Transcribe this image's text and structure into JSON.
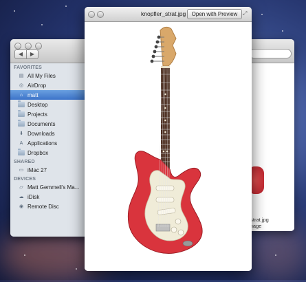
{
  "finder": {
    "sections": [
      {
        "header": "FAVORITES",
        "items": [
          {
            "label": "All My Files",
            "icon": "all-files-icon"
          },
          {
            "label": "AirDrop",
            "icon": "airdrop-icon"
          },
          {
            "label": "matt",
            "icon": "home-icon",
            "selected": true
          },
          {
            "label": "Desktop",
            "icon": "folder-icon"
          },
          {
            "label": "Projects",
            "icon": "folder-icon"
          },
          {
            "label": "Documents",
            "icon": "folder-icon"
          },
          {
            "label": "Downloads",
            "icon": "downloads-icon"
          },
          {
            "label": "Applications",
            "icon": "applications-icon"
          },
          {
            "label": "Dropbox",
            "icon": "folder-icon"
          }
        ]
      },
      {
        "header": "SHARED",
        "items": [
          {
            "label": "iMac 27",
            "icon": "imac-icon"
          }
        ]
      },
      {
        "header": "DEVICES",
        "items": [
          {
            "label": "Matt Gemmell's Ma...",
            "icon": "laptop-icon"
          },
          {
            "label": "iDisk",
            "icon": "idisk-icon"
          },
          {
            "label": "Remote Disc",
            "icon": "disc-icon"
          }
        ]
      }
    ]
  },
  "quicklook": {
    "title": "knopfler_strat.jpg",
    "open_button": "Open with Preview"
  },
  "info_window": {
    "lines": [
      "_strat.jpg",
      "image",
      "B",
      "rch 2011 20:17",
      "rch 2011 20:17",
      "rch 2011 20:17"
    ]
  },
  "colors": {
    "selection": "#3c73c9",
    "guitar_body": "#d9343d",
    "pickguard": "#f0ecd8"
  }
}
